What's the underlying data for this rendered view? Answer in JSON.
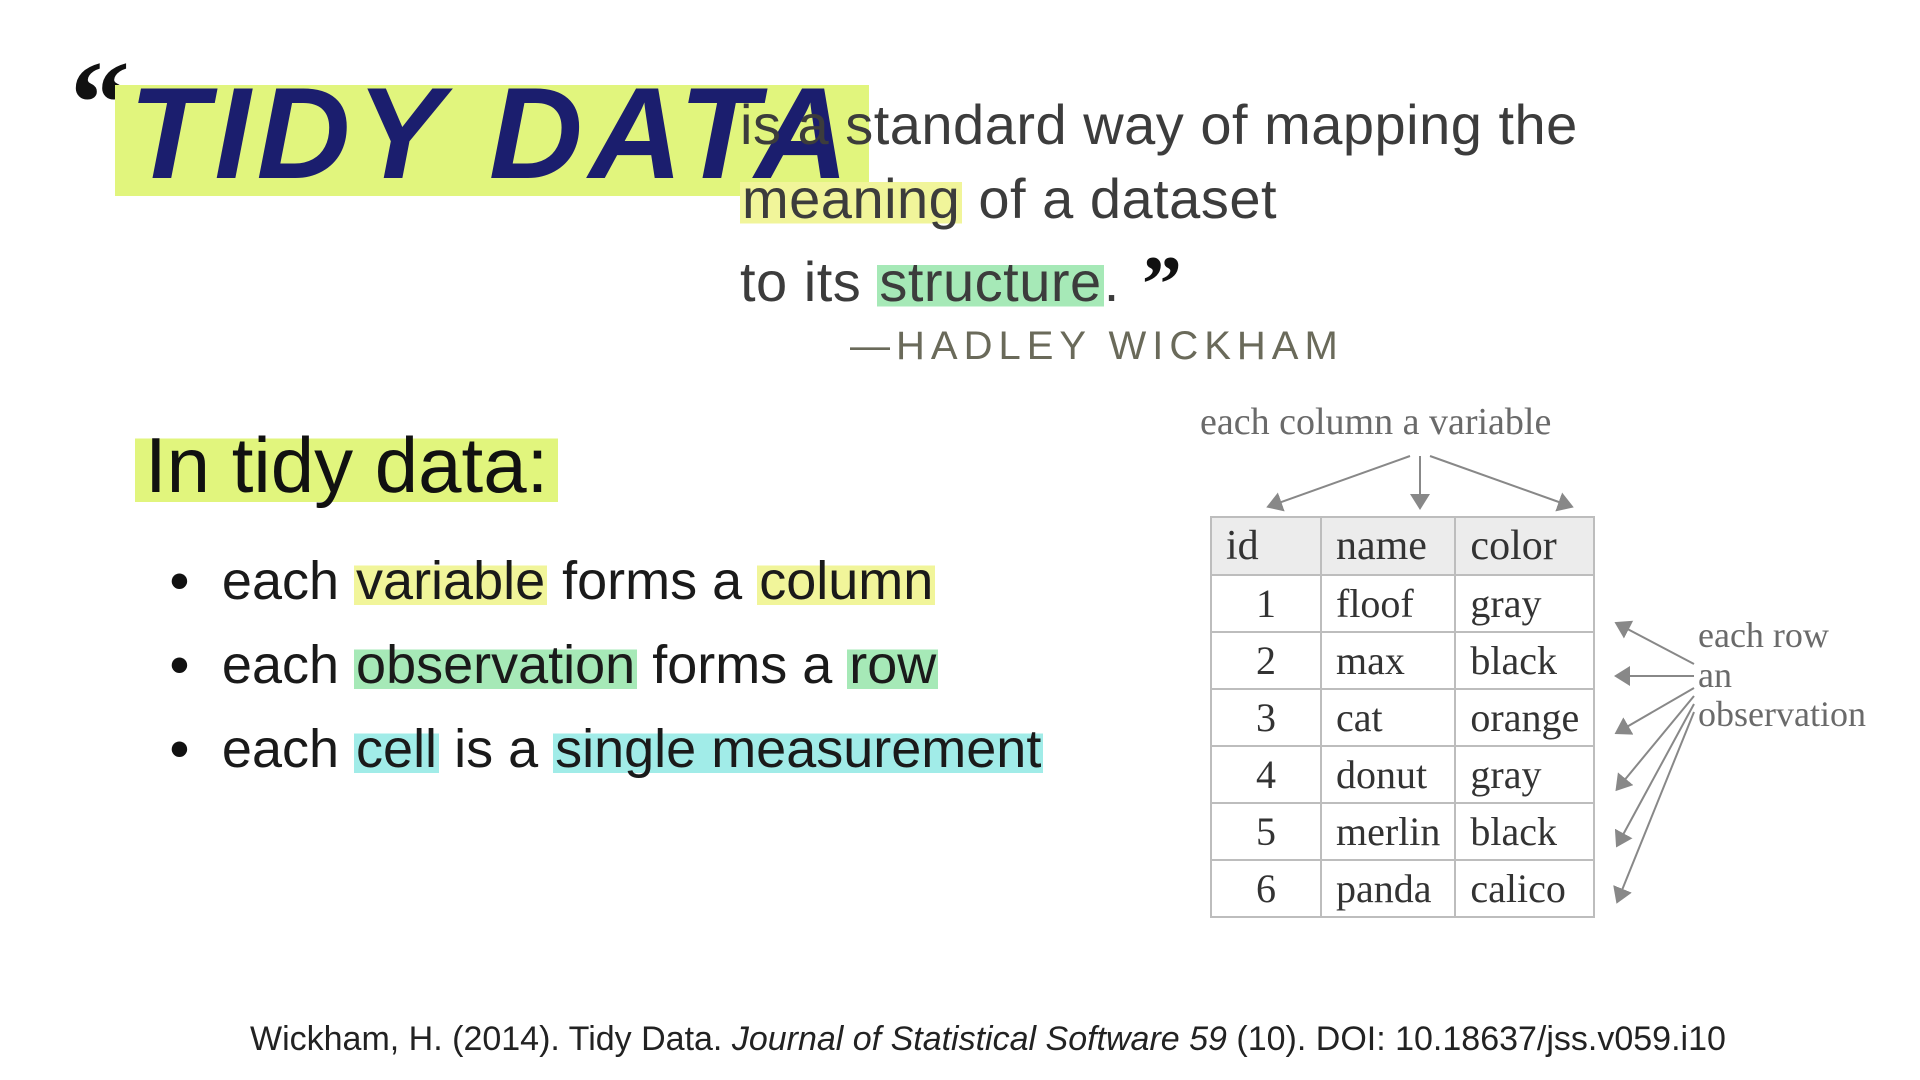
{
  "headline": "TIDY DATA",
  "definition": {
    "line1_a": "is a standard way of mapping the",
    "line2_a": "meaning",
    "line2_b": " of a dataset",
    "line3_a": "to its ",
    "line3_b": "structure",
    "line3_c": "."
  },
  "attribution": "—HADLEY WICKHAM",
  "section_heading": "In tidy data:",
  "bullets": {
    "b1_a": "each ",
    "b1_b": "variable",
    "b1_c": " forms a ",
    "b1_d": "column",
    "b2_a": "each ",
    "b2_b": "observation",
    "b2_c": " forms a ",
    "b2_d": "row",
    "b3_a": "each ",
    "b3_b": "cell",
    "b3_c": " is a ",
    "b3_d": "single measurement"
  },
  "annotations": {
    "columns": "each column a variable",
    "rows_l1": "each row",
    "rows_l2": "an",
    "rows_l3": "observation"
  },
  "table": {
    "headers": [
      "id",
      "name",
      "color"
    ],
    "rows": [
      [
        "1",
        "floof",
        "gray"
      ],
      [
        "2",
        "max",
        "black"
      ],
      [
        "3",
        "cat",
        "orange"
      ],
      [
        "4",
        "donut",
        "gray"
      ],
      [
        "5",
        "merlin",
        "black"
      ],
      [
        "6",
        "panda",
        "calico"
      ]
    ]
  },
  "citation": {
    "pre": "Wickham, H. (2014). Tidy Data. ",
    "ital": "Journal of Statistical Software 59",
    "post": " (10). DOI: 10.18637/jss.v059.i10"
  }
}
